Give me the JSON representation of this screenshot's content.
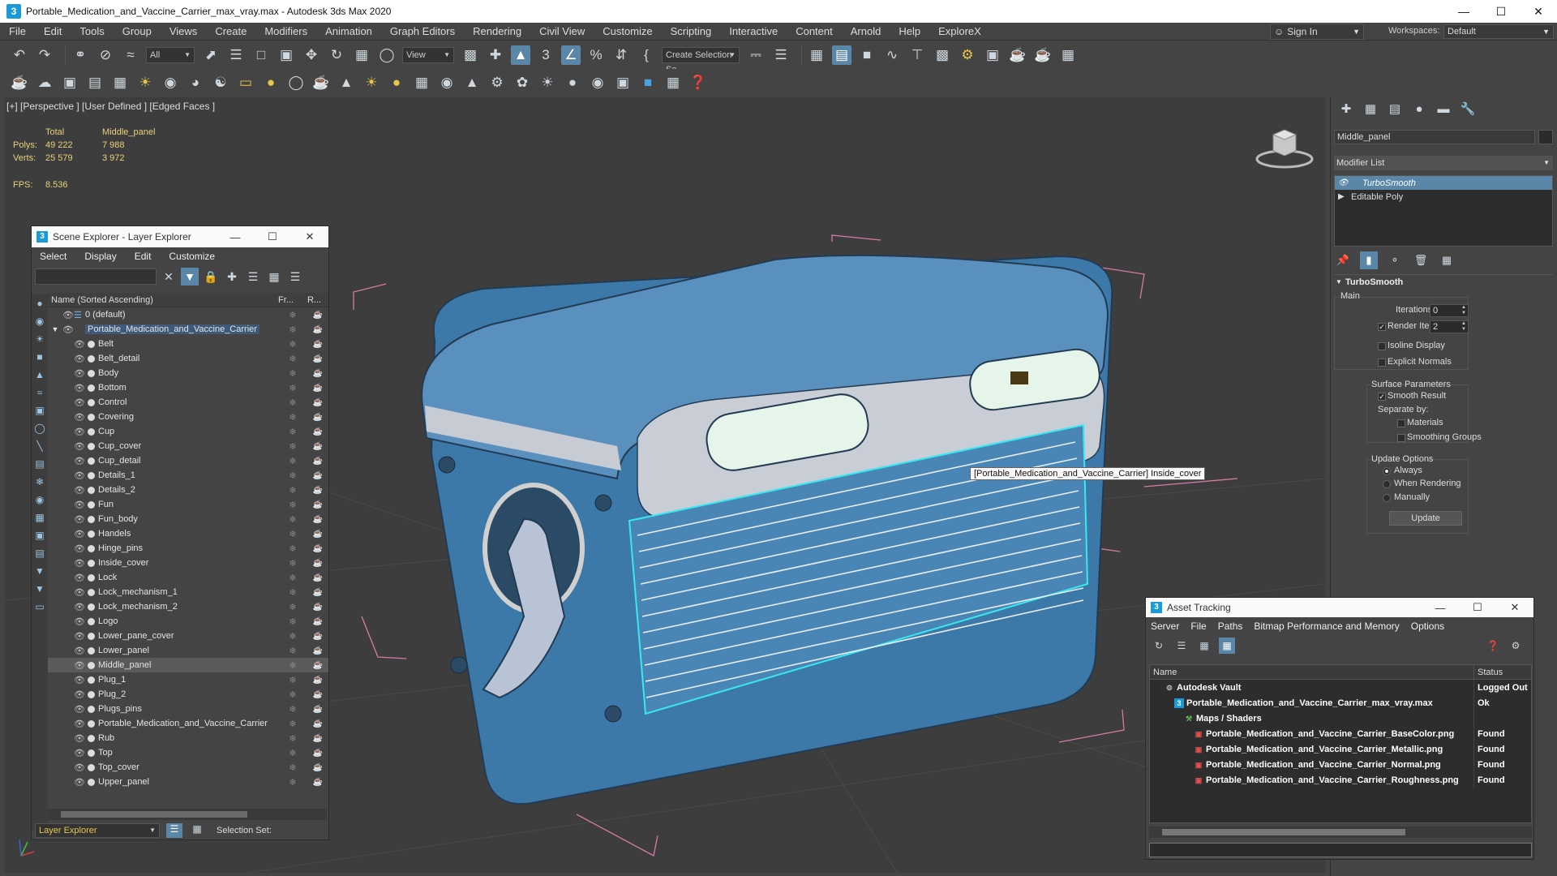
{
  "app": {
    "title": "Portable_Medication_and_Vaccine_Carrier_max_vray.max - Autodesk 3ds Max 2020",
    "logo": "3"
  },
  "menus": [
    "File",
    "Edit",
    "Tools",
    "Group",
    "Views",
    "Create",
    "Modifiers",
    "Animation",
    "Graph Editors",
    "Rendering",
    "Civil View",
    "Customize",
    "Scripting",
    "Interactive",
    "Content",
    "Arnold",
    "Help",
    "ExploreX"
  ],
  "account": {
    "sign_in": "Sign In",
    "workspaces_label": "Workspaces:",
    "workspace": "Default"
  },
  "toolbar": {
    "filter_value": "All",
    "ref_coord": "View",
    "selection_set": "Create Selection Se"
  },
  "viewport": {
    "label": "[+] [Perspective ] [User Defined ] [Edged Faces ]",
    "stats": {
      "col_total": "Total",
      "col_sel": "Middle_panel",
      "polys_label": "Polys:",
      "polys_total": "49 222",
      "polys_sel": "7 988",
      "verts_label": "Verts:",
      "verts_total": "25 579",
      "verts_sel": "3 972"
    },
    "fps_label": "FPS:",
    "fps_value": "8.536",
    "tooltip": "[Portable_Medication_and_Vaccine_Carrier] Inside_cover"
  },
  "scene_explorer": {
    "title": "Scene Explorer - Layer Explorer",
    "menu": [
      "Select",
      "Display",
      "Edit",
      "Customize"
    ],
    "col_name": "Name (Sorted Ascending)",
    "col_fr": "Fr...",
    "col_r": "R...",
    "layer_default": "0 (default)",
    "layer_main": "Portable_Medication_and_Vaccine_Carrier",
    "objects": [
      "Belt",
      "Belt_detail",
      "Body",
      "Bottom",
      "Control",
      "Covering",
      "Cup",
      "Cup_cover",
      "Cup_detail",
      "Details_1",
      "Details_2",
      "Fun",
      "Fun_body",
      "Handels",
      "Hinge_pins",
      "Inside_cover",
      "Lock",
      "Lock_mechanism_1",
      "Lock_mechanism_2",
      "Logo",
      "Lower_pane_cover",
      "Lower_panel",
      "Middle_panel",
      "Plug_1",
      "Plug_2",
      "Plugs_pins",
      "Portable_Medication_and_Vaccine_Carrier",
      "Rub",
      "Top",
      "Top_cover",
      "Upper_panel"
    ],
    "selected": "Middle_panel",
    "bottom_dropdown": "Layer Explorer",
    "selection_set_label": "Selection Set:"
  },
  "command_panel": {
    "object_name": "Middle_panel",
    "modifier_list": "Modifier List",
    "stack": [
      "TurboSmooth",
      "Editable Poly"
    ],
    "rollout": "TurboSmooth",
    "main_label": "Main",
    "iterations_label": "Iterations:",
    "iterations": "0",
    "render_iters_label": "Render Iters:",
    "render_iters": "2",
    "isoline": "Isoline Display",
    "explicit_normals": "Explicit Normals",
    "surface_params": "Surface Parameters",
    "smooth_result": "Smooth Result",
    "separate_by": "Separate by:",
    "materials": "Materials",
    "smoothing_groups": "Smoothing Groups",
    "update_options": "Update Options",
    "always": "Always",
    "when_rendering": "When Rendering",
    "manually": "Manually",
    "update_btn": "Update"
  },
  "asset_tracking": {
    "title": "Asset Tracking",
    "menu": [
      "Server",
      "File",
      "Paths",
      "Bitmap Performance and Memory",
      "Options"
    ],
    "col_name": "Name",
    "col_status": "Status",
    "rows": [
      {
        "name": "Autodesk Vault",
        "status": "Logged Out",
        "indent": 0
      },
      {
        "name": "Portable_Medication_and_Vaccine_Carrier_max_vray.max",
        "status": "Ok",
        "indent": 1
      },
      {
        "name": "Maps / Shaders",
        "status": "",
        "indent": 2
      },
      {
        "name": "Portable_Medication_and_Vaccine_Carrier_BaseColor.png",
        "status": "Found",
        "indent": 3
      },
      {
        "name": "Portable_Medication_and_Vaccine_Carrier_Metallic.png",
        "status": "Found",
        "indent": 3
      },
      {
        "name": "Portable_Medication_and_Vaccine_Carrier_Normal.png",
        "status": "Found",
        "indent": 3
      },
      {
        "name": "Portable_Medication_and_Vaccine_Carrier_Roughness.png",
        "status": "Found",
        "indent": 3
      }
    ]
  },
  "colors": {
    "model_blue": "#3a7cab",
    "selection_cyan": "#38e8f0",
    "stat_yellow": "#e8d27a",
    "highlight": "#5a86a8"
  }
}
